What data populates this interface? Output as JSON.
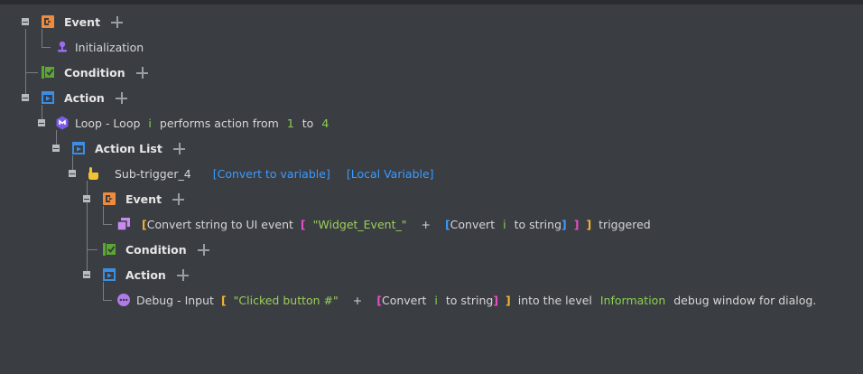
{
  "tree": {
    "root_event": {
      "label": "Event",
      "icon": "event-icon"
    },
    "initialization": {
      "label": "Initialization",
      "icon": "person-icon"
    },
    "root_condition": {
      "label": "Condition",
      "icon": "condition-icon"
    },
    "root_action": {
      "label": "Action",
      "icon": "action-icon"
    },
    "loop": {
      "icon": "loop-icon",
      "prefix": "Loop - Loop",
      "variable": "i",
      "middle": "performs action from",
      "from": "1",
      "to_label": "to",
      "to": "4"
    },
    "action_list": {
      "label": "Action List",
      "icon": "action-icon"
    },
    "subtrigger": {
      "icon": "hand-pointer-icon",
      "label": "Sub-trigger_4",
      "convert_link": "[Convert to variable]",
      "local_link": "[Local Variable]"
    },
    "sub_event": {
      "label": "Event",
      "icon": "event-icon"
    },
    "ui_event": {
      "icon": "ui-widget-icon",
      "open": "[",
      "convert_text": "Convert string to UI event",
      "open2": "[",
      "string_value": "\"Widget_Event_\"",
      "plus_op": "+",
      "open3": "[",
      "convert2": "Convert",
      "variable": "i",
      "to_string": "to string",
      "close3": "]",
      "close2": "]",
      "close1": "]",
      "suffix": "triggered"
    },
    "sub_condition": {
      "label": "Condition",
      "icon": "condition-icon"
    },
    "sub_action": {
      "label": "Action",
      "icon": "action-icon"
    },
    "debug": {
      "icon": "debug-icon",
      "prefix": "Debug - Input",
      "open": "[",
      "string_value": "\"Clicked button #\"",
      "plus_op": "+",
      "open2": "[",
      "convert": "Convert",
      "variable": "i",
      "to_string": "to string",
      "close2": "]",
      "close1": "]",
      "middle": "into the level",
      "level": "Information",
      "suffix": "debug window for dialog."
    }
  },
  "colors": {
    "background": "#3a3d42",
    "event_orange": "#f08a3c",
    "condition_green": "#5aa832",
    "action_blue": "#3a8ee6",
    "param_green": "#8bd050",
    "link_blue": "#3b9bff",
    "bracket_yellow": "#f5b62e",
    "bracket_pink": "#e64fc8",
    "purple": "#9b6cf0"
  }
}
